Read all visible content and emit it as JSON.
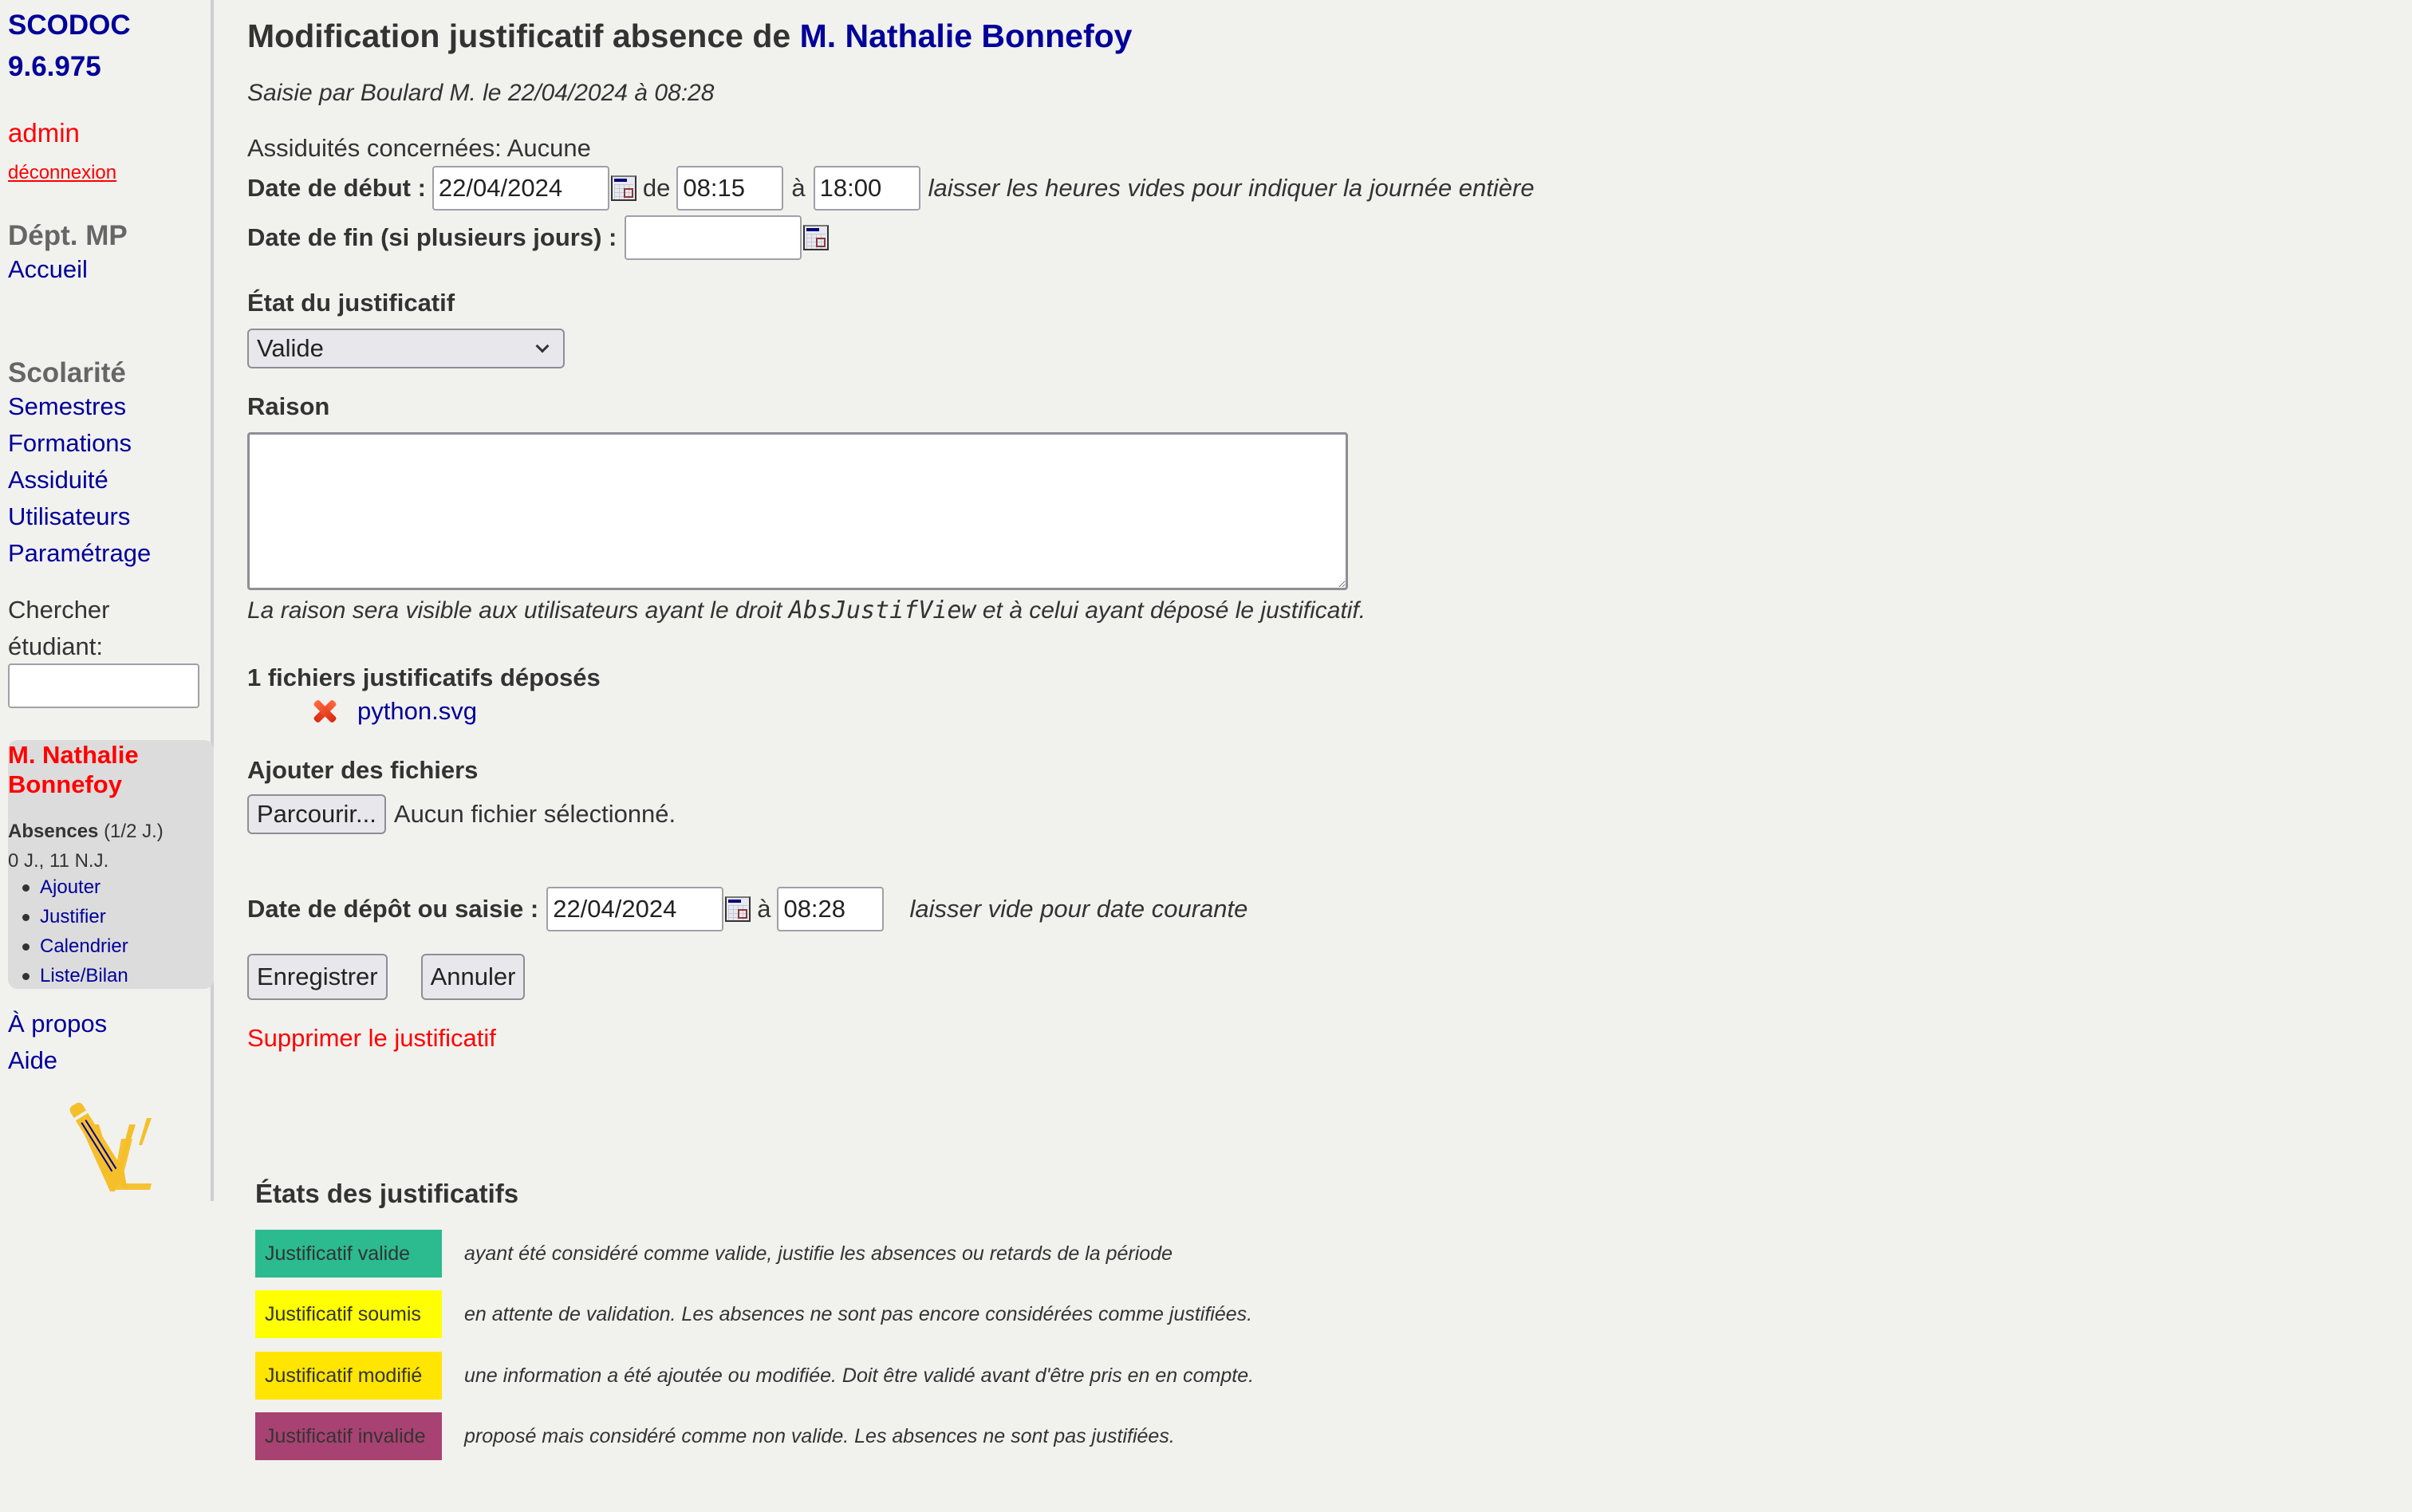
{
  "sidebar": {
    "app_name": "SCODOC",
    "version": "9.6.975",
    "user": "admin",
    "logout": "déconnexion",
    "department": "Dépt. MP",
    "home": "Accueil",
    "section_title": "Scolarité",
    "nav": [
      "Semestres",
      "Formations",
      "Assiduité",
      "Utilisateurs",
      "Paramétrage"
    ],
    "search_label_line1": "Chercher",
    "search_label_line2": "étudiant:",
    "search_value": "",
    "student": {
      "name": "M. Nathalie Bonnefoy",
      "absences_label": "Absences",
      "absences_unit": "(1/2 J.)",
      "absences_counts": "0 J., 11 N.J.",
      "links": [
        "Ajouter",
        "Justifier",
        "Calendrier",
        "Liste/Bilan"
      ]
    },
    "about": "À propos",
    "help": "Aide",
    "logo_icon": "pencil-vl-logo"
  },
  "header": {
    "title_prefix": "Modification justificatif absence de",
    "student_name": "M. Nathalie Bonnefoy",
    "entered_by": "Saisie par Boulard M. le 22/04/2024 à 08:28",
    "concerned": "Assiduités concernées: Aucune"
  },
  "form": {
    "start_label": "Date de début :",
    "start_date": "22/04/2024",
    "from_word": "de",
    "start_time": "08:15",
    "to_word": "à",
    "end_time": "18:00",
    "hours_hint": "laisser les heures vides pour indiquer la journée entière",
    "end_label": "Date de fin (si plusieurs jours) :",
    "end_date": "",
    "state_label": "État du justificatif",
    "state_value": "Valide",
    "reason_label": "Raison",
    "reason_value": "",
    "reason_note_before": "La raison sera visible aux utilisateurs ayant le droit ",
    "reason_note_code": "AbsJustifView",
    "reason_note_after": " et à celui ayant déposé le justificatif.",
    "files_label": "1 fichiers justificatifs déposés",
    "files": [
      {
        "name": "python.svg",
        "delete_icon": "delete-x-icon"
      }
    ],
    "add_files_label": "Ajouter des fichiers",
    "browse_button": "Parcourir...",
    "no_file_selected": "Aucun fichier sélectionné.",
    "deposit_label": "Date de dépôt ou saisie :",
    "deposit_date": "22/04/2024",
    "deposit_at": "à",
    "deposit_time": "08:28",
    "deposit_hint": "laisser vide pour date courante",
    "save_button": "Enregistrer",
    "cancel_button": "Annuler",
    "delete_link": "Supprimer le justificatif"
  },
  "legend": {
    "title": "États des justificatifs",
    "items": [
      {
        "label": "Justificatif valide",
        "color": "#2bbb8f",
        "desc": "ayant été considéré comme valide, justifie les absences ou retards de la période"
      },
      {
        "label": "Justificatif soumis",
        "color": "#ffff00",
        "desc": "en attente de validation. Les absences ne sont pas encore considérées comme justifiées."
      },
      {
        "label": "Justificatif modifié",
        "color": "#ffe500",
        "desc": "une information a été ajoutée ou modifiée. Doit être validé avant d'être pris en en compte."
      },
      {
        "label": "Justificatif invalide",
        "color": "#a84272",
        "desc": "proposé mais considéré comme non valide. Les absences ne sont pas justifiées."
      }
    ]
  },
  "colors": {
    "link": "#000099",
    "alert": "#ff0000",
    "background": "#f1f1ee"
  }
}
